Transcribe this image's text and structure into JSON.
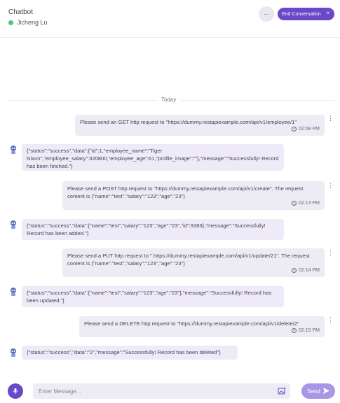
{
  "header": {
    "title": "Chatbot",
    "user_name": "Jicheng Lu",
    "more_label": "···",
    "end_label": "End Conversation",
    "end_close": "×"
  },
  "day_label": "Today",
  "messages": [
    {
      "role": "user",
      "text": "Please send an GET http request to \"https://dummy.restapiexample.com/api/v1/employee/1\"",
      "time": "02:08 PM"
    },
    {
      "role": "bot",
      "text": "{\"status\":\"success\",\"data\":{\"id\":1,\"employee_name\":\"Tiger Nixon\",\"employee_salary\":320800,\"employee_age\":61,\"profile_image\":\"\"},\"message\":\"Successfully! Record has been fetched.\"}"
    },
    {
      "role": "user",
      "text": "Please send a POST http request to \"https://dummy.restapiexample.com/api/v1/create\". The request content is {\"name\":\"test\",\"salary\":\"123\",\"age\":\"23\"}",
      "time": "02:13 PM"
    },
    {
      "role": "bot",
      "text": "{\"status\":\"success\",\"data\":{\"name\":\"test\",\"salary\":\"123\",\"age\":\"23\",\"id\":9383},\"message\":\"Successfully! Record has been added.\"}"
    },
    {
      "role": "user",
      "text": "Please send a PUT http request to \" https://dummy.restapiexample.com/api/v1/update/21\". The request content is {\"name\":\"test\",\"salary\":\"123\",\"age\":\"23\"}",
      "time": "02:14 PM"
    },
    {
      "role": "bot",
      "text": "{\"status\":\"success\",\"data\":{\"name\":\"test\",\"salary\":\"123\",\"age\":\"23\"},\"message\":\"Successfully! Record has been updated.\"}"
    },
    {
      "role": "user",
      "text": "Please send a DELETE http request to \"https://dummy.restapiexample.com/api/v1/delete/2\"",
      "time": "02:15 PM"
    },
    {
      "role": "bot",
      "text": "{\"status\":\"success\",\"data\":\"2\",\"message\":\"Successfully! Record has been deleted\"}"
    }
  ],
  "composer": {
    "placeholder": "Enter Message...",
    "send_label": "Send"
  },
  "colors": {
    "accent": "#6a48c8",
    "send_button": "#a996e6",
    "user_bubble": "#edecf4",
    "bot_bubble": "#eeeaf8",
    "online": "#4cc47a"
  },
  "icons": {
    "more": "ellipsis-icon",
    "close": "close-icon",
    "time": "clock-icon",
    "message_menu": "kebab-menu-icon",
    "bot": "robot-avatar-icon",
    "mic": "microphone-icon",
    "attach": "image-attach-icon",
    "send": "send-arrow-icon"
  }
}
